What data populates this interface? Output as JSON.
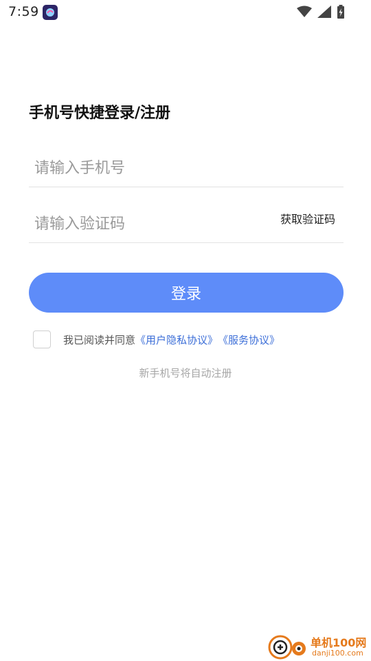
{
  "status_bar": {
    "time": "7:59"
  },
  "login": {
    "title": "手机号快捷登录/注册",
    "phone_placeholder": "请输入手机号",
    "code_placeholder": "请输入验证码",
    "get_code_label": "获取验证码",
    "login_button_label": "登录",
    "agreement_prefix": "我已阅读并同意",
    "privacy_link": "《用户隐私协议》",
    "service_link": "《服务协议》",
    "note": "新手机号将自动注册"
  },
  "colors": {
    "accent": "#5e8cf9",
    "link": "#3d6fd8",
    "watermark": "#e57a1c"
  },
  "watermark": {
    "text": "单机100网",
    "sub": "danji100.com"
  }
}
